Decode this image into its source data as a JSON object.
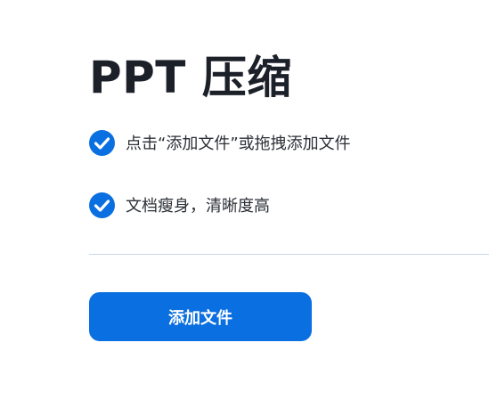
{
  "title": "PPT 压缩",
  "features": [
    {
      "text": "点击“添加文件”或拖拽添加文件",
      "icon": "check-circle-icon"
    },
    {
      "text": "文档瘦身，清晰度高",
      "icon": "check-circle-icon"
    }
  ],
  "add_button_label": "添加文件",
  "colors": {
    "accent": "#0a6fe0",
    "title": "#1c2029",
    "text": "#2b2f36",
    "divider": "#c9d6e6"
  }
}
